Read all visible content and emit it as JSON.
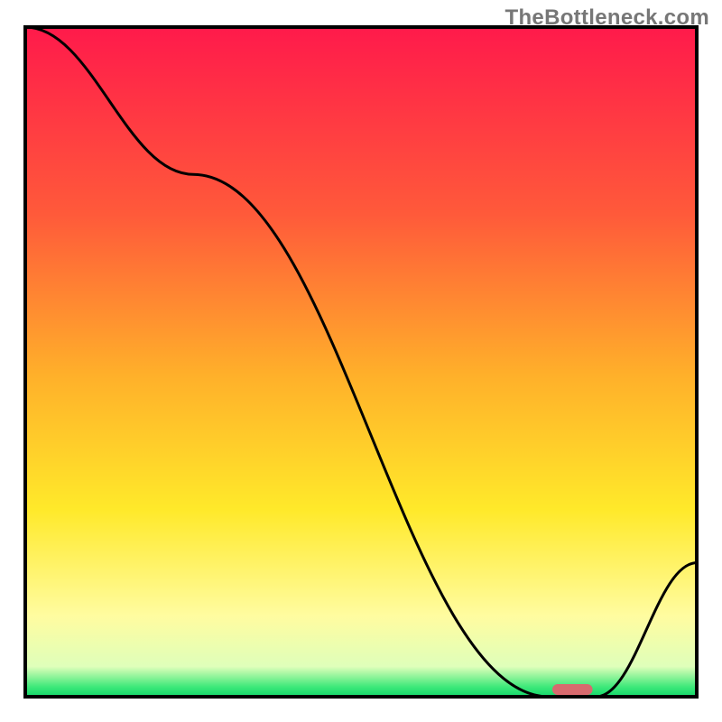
{
  "watermark": "TheBottleneck.com",
  "chart_data": {
    "type": "line",
    "title": "",
    "xlabel": "",
    "ylabel": "",
    "xlim": [
      0,
      100
    ],
    "ylim": [
      0,
      100
    ],
    "grid": false,
    "legend": false,
    "x": [
      0,
      25,
      78,
      85,
      100
    ],
    "y": [
      100,
      78,
      0,
      0,
      20
    ],
    "marker": {
      "x": 81.5,
      "width": 6,
      "color": "#d86a6e"
    },
    "gradient_stops": [
      {
        "pos": 0.0,
        "color": "#ff1a4b"
      },
      {
        "pos": 0.28,
        "color": "#ff5a3a"
      },
      {
        "pos": 0.52,
        "color": "#ffb02a"
      },
      {
        "pos": 0.72,
        "color": "#ffe92a"
      },
      {
        "pos": 0.88,
        "color": "#fffca0"
      },
      {
        "pos": 0.955,
        "color": "#dfffba"
      },
      {
        "pos": 0.985,
        "color": "#3fe97a"
      },
      {
        "pos": 1.0,
        "color": "#12d66a"
      }
    ],
    "frame_color": "#000000",
    "line_color": "#000000"
  }
}
